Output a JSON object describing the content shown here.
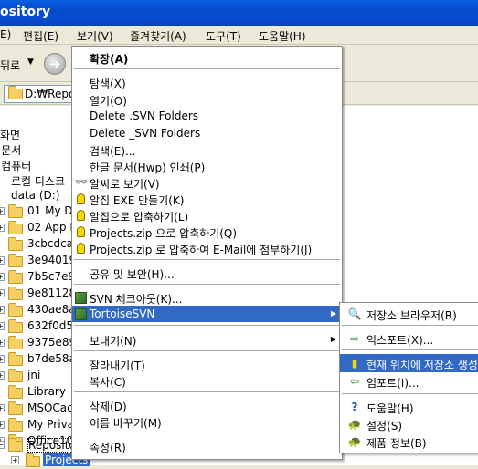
{
  "window": {
    "title": "ository"
  },
  "menubar": [
    "E)",
    "편집(E)",
    "보기(V)",
    "즐겨찾기(A)",
    "도구(T)",
    "도움말(H)"
  ],
  "toolbar": {
    "back_label": "뒤로",
    "back_dropdown": "▼",
    "forward_glyph": "➜"
  },
  "address": {
    "value": "D:₩Repo"
  },
  "tree": [
    {
      "label": "화면"
    },
    {
      "label": "l 문서"
    },
    {
      "label": "l 컴퓨터"
    },
    {
      "label": "로컬 디스크"
    },
    {
      "label": "data (D:)"
    },
    {
      "label": "01 My D"
    },
    {
      "label": "02 App D"
    },
    {
      "label": "3cbcdca"
    },
    {
      "label": "3e940195"
    },
    {
      "label": "7b5c7e9"
    },
    {
      "label": "9e811289"
    },
    {
      "label": "430ae8a"
    },
    {
      "label": "632f0d52"
    },
    {
      "label": "9375e89f"
    },
    {
      "label": "b7de58a"
    },
    {
      "label": "jni"
    },
    {
      "label": "Library"
    },
    {
      "label": "MSOCac"
    },
    {
      "label": "My Priva"
    },
    {
      "label": "Office10"
    },
    {
      "label": "Reposito"
    },
    {
      "label": "Projects"
    }
  ],
  "context_menu": {
    "items": [
      {
        "label": "확장(A)"
      },
      {
        "label": "탐색(X)"
      },
      {
        "label": "열기(O)"
      },
      {
        "label": "Delete .SVN Folders"
      },
      {
        "label": "Delete _SVN Folders"
      },
      {
        "label": "검색(E)..."
      },
      {
        "label": "한글 문서(Hwp) 인쇄(P)"
      },
      {
        "label": "알씨로 보기(V)"
      },
      {
        "label": "알집 EXE 만들기(K)"
      },
      {
        "label": "알집으로 압축하기(L)"
      },
      {
        "label": "Projects.zip 으로 압축하기(Q)"
      },
      {
        "label": "Projects.zip 로 압축하여 E-Mail에 첨부하기(J)"
      },
      {
        "label": "공유 및 보안(H)..."
      },
      {
        "label": "SVN 체크아웃(K)..."
      },
      {
        "label": "TortoiseSVN"
      },
      {
        "label": "보내기(N)"
      },
      {
        "label": "잘라내기(T)"
      },
      {
        "label": "복사(C)"
      },
      {
        "label": "삭제(D)"
      },
      {
        "label": "이름 바꾸기(M)"
      },
      {
        "label": "속성(R)"
      }
    ],
    "submenu_arrow": "▶"
  },
  "submenu": {
    "items": [
      {
        "label": "저장소 브라우저(R)"
      },
      {
        "label": "익스포트(X)..."
      },
      {
        "label": "현재 위치에 저장소 생성"
      },
      {
        "label": "임포트(I)..."
      },
      {
        "label": "도움말(H)"
      },
      {
        "label": "설정(S)"
      },
      {
        "label": "제품 정보(B)"
      }
    ]
  },
  "colors": {
    "highlight": "#316ac5",
    "titlebar": "#0a4ed6"
  }
}
